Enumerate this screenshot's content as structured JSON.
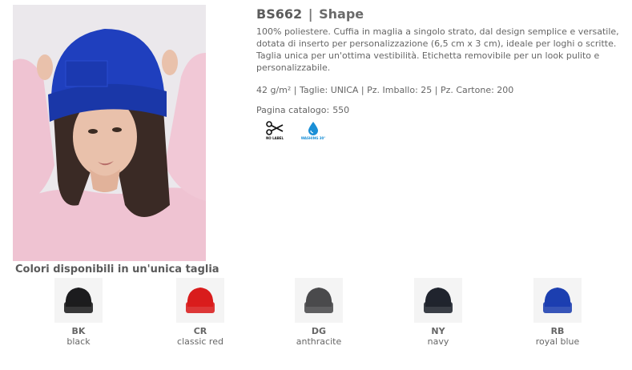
{
  "product": {
    "code": "BS662",
    "separator": "|",
    "name": "Shape",
    "description": "100% poliestere. Cuffia in maglia a singolo strato, dal design semplice e versatile, dotata di inserto per personalizzazione (6,5 cm x 3 cm), ideale per loghi o scritte. Taglia unica per un'ottima vestibilità. Etichetta removibile per un look pulito e personalizzabile.",
    "specs": "42 g/m² | Taglie: UNICA | Pz. Imballo: 25 | Pz. Cartone: 200",
    "catalog_label": "Pagina catalogo:",
    "catalog_page": "550",
    "photo_icon": "model-wearing-royal-blue-beanie-photo"
  },
  "care_icons": [
    {
      "icon": "scissors-icon",
      "label": "NO LABEL"
    },
    {
      "icon": "water-drop-icon",
      "label": "WASHING 30°"
    }
  ],
  "colors_heading": "Colori disponibili in un'unica taglia",
  "colors": [
    {
      "code": "BK",
      "name": "black",
      "hex": "#1c1c1e"
    },
    {
      "code": "CR",
      "name": "classic red",
      "hex": "#d91c1c"
    },
    {
      "code": "DG",
      "name": "anthracite",
      "hex": "#4a4a4c"
    },
    {
      "code": "NY",
      "name": "navy",
      "hex": "#20242e"
    },
    {
      "code": "RB",
      "name": "royal blue",
      "hex": "#1c3fb0"
    }
  ]
}
